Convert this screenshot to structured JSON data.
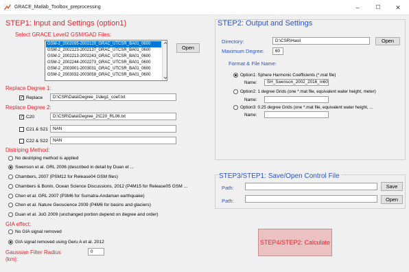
{
  "window": {
    "title": "GRACE_Matlab_Toolbox_preprocessing",
    "minimize_glyph": "–",
    "maximize_glyph": "☐",
    "close_glyph": "✕"
  },
  "step1": {
    "heading": "STEP1: Input and Settings (option1)",
    "select_label": "Select GRACE Level2 GSM/GAD Files:",
    "files": [
      "GSM-2_2002095-2002120_GRAC_UTCSR_BA01_0600",
      "GSM-2_2002123-2002137_GRAC_UTCSR_BA01_0600",
      "GSM-2_2002213-2002243_GRAC_UTCSR_BA01_0600",
      "GSM-2_2002244-2002273_GRAC_UTCSR_BA01_0600",
      "GSM-2_2003001-2003031_GRAC_UTCSR_BA01_0600",
      "GSM-2_2003032-2003059_GRAC_UTCSR_BA01_0600"
    ],
    "open_label": "Open",
    "degree1_heading": "Replace Degree 1:",
    "replace_label": "Replace",
    "replace_checked": true,
    "degree1_path": "D:\\CSR\\Data\\Degree_1\\deg1_coef.txt",
    "degree2_heading": "Replace Degree 2:",
    "c20_label": "C20",
    "c20_checked": true,
    "c20_value": "D:\\CSR\\Data\\Degree_2\\C20_RL06.txt",
    "c21_label": "C21 & S21",
    "c21_checked": false,
    "c21_value": "NAN",
    "c22_label": "C22 & S22",
    "c22_checked": false,
    "c22_value": "NAN",
    "destriping_heading": "Distriping Method:",
    "destriping_options": [
      "No destriping method is applied",
      "Swenson et al. GRL 2006 (described in detail by Duan et ...",
      "Chambers, 2007 (PSM12 for Release04 GSM files)",
      "Chambers & Bonin, Ocean Science Discussions, 2012 (P4M15 for Release05 GSM ...",
      "Chen et al. GRL 2007 (P3M6 for Sumatra-Andaman earthquake)",
      "Chen et al. Nature Geoscience 2009 (P4M6 for basins and glaciers)",
      "Duan et al. JoG 2009 (unchanged portion depend on degree and order)"
    ],
    "destriping_selected": 1,
    "gia_heading": "GIA effect:",
    "gia_options": [
      "No GIA signal removed",
      "GIA signal removed using Geru A et al. 2012"
    ],
    "gia_selected": 1,
    "gaussian_label_1": "Gaussian Filter Radius",
    "gaussian_label_2": "(km):",
    "gaussian_value": "0"
  },
  "step2": {
    "heading": "STEP2: Output and Settings",
    "directory_label": "Directory:",
    "directory_value": "D:\\CSR\\Hasil",
    "open_label": "Open",
    "max_degree_label": "Maximum Degree:",
    "max_degree_value": "60",
    "format_heading": "Format & File Name:",
    "options": [
      {
        "label": "Option1: Sphere Harmonic Coefficients (*.mat file)",
        "name_label": "Name:",
        "name_value": "SH_Swenson_2002_2016_m60"
      },
      {
        "label": "Option2: 1 degree Grids (one *.mat file, equivalent water height, meter)",
        "name_label": "Name:",
        "name_value": ""
      },
      {
        "label": "Option3: 0.25 degree Grids (one *.mat file, equivalent water height, ...",
        "name_label": "Name:",
        "name_value": ""
      }
    ],
    "selected_option": 0
  },
  "step3": {
    "heading": "STEP3/STEP1: Save/Open Control File",
    "path_label": "Path:",
    "save_label": "Save",
    "open_label": "Open",
    "save_path": "",
    "open_path": ""
  },
  "step4": {
    "calc_label": "STEP4/STEP2: Calculate"
  },
  "colors": {
    "red_heading": "#e8232a",
    "blue_heading": "#2b52c8",
    "selection": "#0078d7",
    "calc_button_bg": "#ebc1c1"
  }
}
